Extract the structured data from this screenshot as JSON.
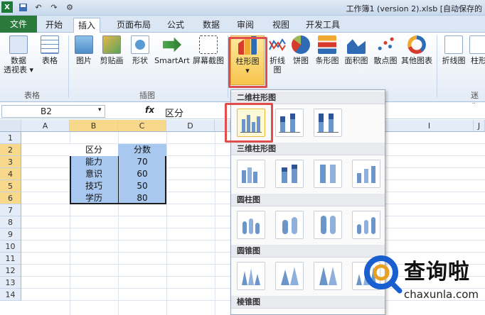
{
  "qat": {
    "icons": [
      "excel-icon",
      "save-icon",
      "undo-icon",
      "redo-icon",
      "custom-icon"
    ]
  },
  "window": {
    "title": "工作簿1 (version 2).xlsb [自动保存的"
  },
  "tabs": {
    "file": "文件",
    "items": [
      {
        "label": "开始"
      },
      {
        "label": "插入"
      },
      {
        "label": "页面布局"
      },
      {
        "label": "公式"
      },
      {
        "label": "数据"
      },
      {
        "label": "审阅"
      },
      {
        "label": "视图"
      },
      {
        "label": "开发工具"
      }
    ]
  },
  "ribbon": {
    "buttons": [
      {
        "label": "数据",
        "label2": "透视表 ▾"
      },
      {
        "label": "表格"
      },
      {
        "label": "图片"
      },
      {
        "label": "剪贴画"
      },
      {
        "label": "形状"
      },
      {
        "label": "SmartArt"
      },
      {
        "label": "屏幕截图"
      },
      {
        "label": "柱形图"
      },
      {
        "label": "折线图"
      },
      {
        "label": "饼图"
      },
      {
        "label": "条形图"
      },
      {
        "label": "面积图"
      },
      {
        "label": "散点图"
      },
      {
        "label": "其他图表"
      },
      {
        "label": "折线图"
      },
      {
        "label": "柱形"
      }
    ],
    "groups": {
      "tables": "表格",
      "illustrations": "插图",
      "sparklines": "迷你"
    }
  },
  "formula_bar": {
    "cell_ref": "B2",
    "fx": "fx",
    "value": "区分"
  },
  "grid": {
    "columns": [
      "A",
      "B",
      "C",
      "D",
      "I",
      "J"
    ],
    "rows": [
      "1",
      "2",
      "3",
      "4",
      "5",
      "6",
      "7",
      "8",
      "9",
      "10",
      "11",
      "12",
      "13",
      "14"
    ],
    "headers": [
      "区分",
      "分数"
    ],
    "data": [
      {
        "label": "能力",
        "value": "70"
      },
      {
        "label": "意识",
        "value": "60"
      },
      {
        "label": "技巧",
        "value": "50"
      },
      {
        "label": "学历",
        "value": "80"
      }
    ]
  },
  "dropdown": {
    "sections": [
      {
        "title": "二维柱形图"
      },
      {
        "title": "三维柱形图"
      },
      {
        "title": "圆柱图"
      },
      {
        "title": "圆锥图"
      },
      {
        "title": "棱锥图"
      }
    ]
  },
  "watermark": {
    "brand": "查询啦",
    "url": "chaxunla.com"
  },
  "colors": {
    "file_tab": "#2a7a3b",
    "highlight": "#e04d4d",
    "selection_fill": "#a9c8ef",
    "header_selected": "#f8d88a"
  }
}
